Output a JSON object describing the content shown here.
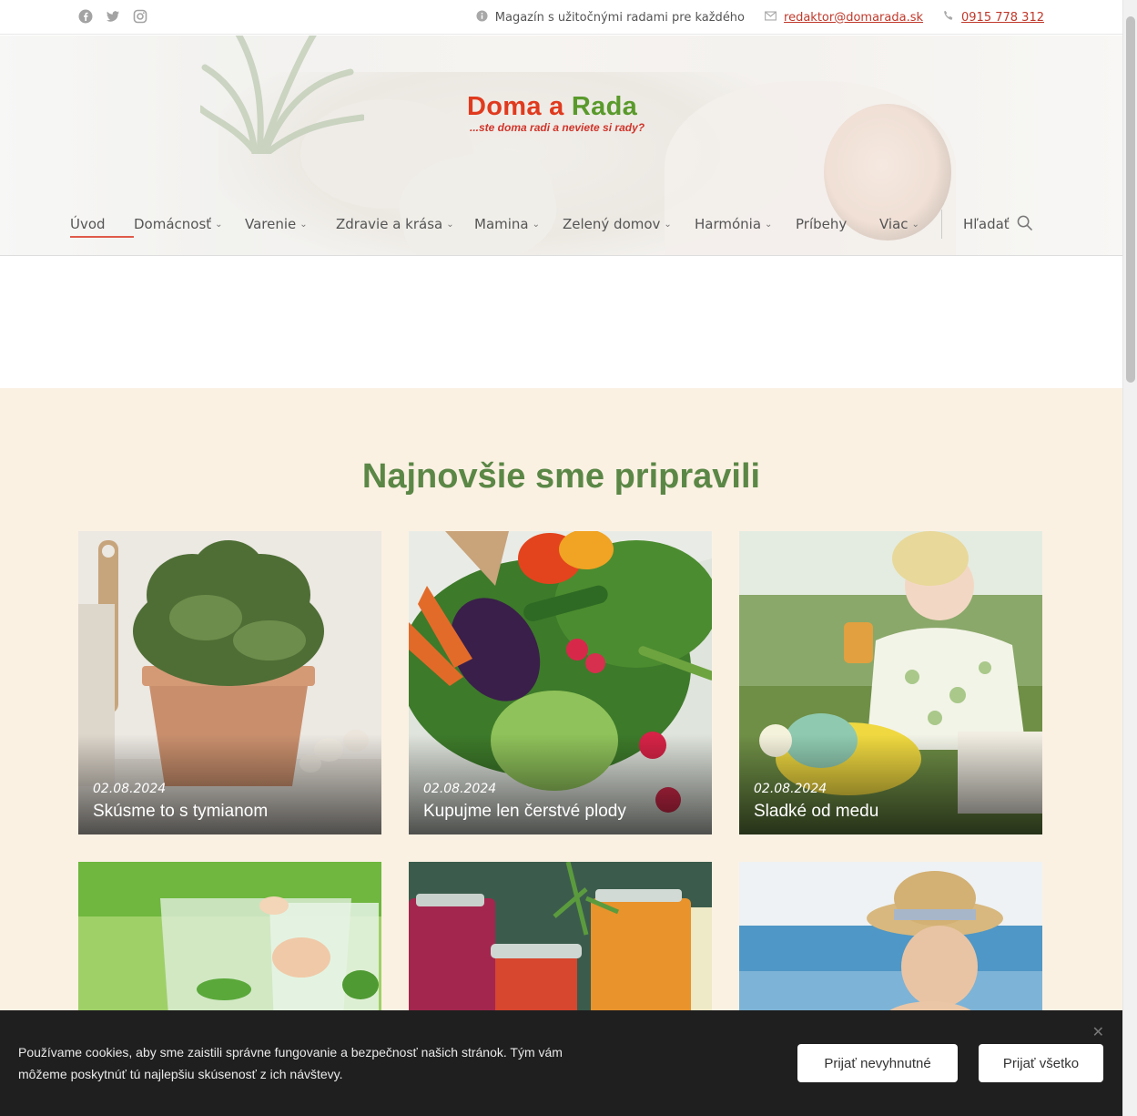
{
  "topbar": {
    "social": [
      "facebook-icon",
      "twitter-icon",
      "instagram-icon"
    ],
    "tagline": "Magazín s užitočnými radami pre každého",
    "email": "redaktor@domarada.sk",
    "phone": "0915 778 312"
  },
  "logo": {
    "word1": "Doma a",
    "word2": "Rada",
    "slogan": "...ste doma radi a neviete si rady?"
  },
  "nav": {
    "items": [
      {
        "label": "Úvod",
        "dropdown": false,
        "active": true
      },
      {
        "label": "Domácnosť",
        "dropdown": true
      },
      {
        "label": "Varenie",
        "dropdown": true
      },
      {
        "label": "Zdravie a krása",
        "dropdown": true
      },
      {
        "label": "Mamina",
        "dropdown": true
      },
      {
        "label": "Zelený domov",
        "dropdown": true
      },
      {
        "label": "Harmónia",
        "dropdown": true
      },
      {
        "label": "Príbehy",
        "dropdown": false
      },
      {
        "label": "Viac",
        "dropdown": true
      }
    ],
    "search_label": "Hľadať"
  },
  "section": {
    "heading": "Najnovšie sme pripravili",
    "cards": [
      {
        "date": "02.08.2024",
        "title": "Skúsme to s tymianom"
      },
      {
        "date": "02.08.2024",
        "title": "Kupujme len čerstvé plody"
      },
      {
        "date": "02.08.2024",
        "title": "Sladké od medu"
      }
    ]
  },
  "cookie": {
    "text": "Používame cookies, aby sme zaistili správne fungovanie a bezpečnosť našich stránok. Tým vám môžeme poskytnúť tú najlepšiu skúsenosť z ich návštevy.",
    "btn_necessary": "Prijať nevyhnutné",
    "btn_all": "Prijať všetko"
  },
  "colors": {
    "accent": "#c0392b",
    "heading_green": "#5b8746",
    "section_bg": "#fbf1e3"
  }
}
